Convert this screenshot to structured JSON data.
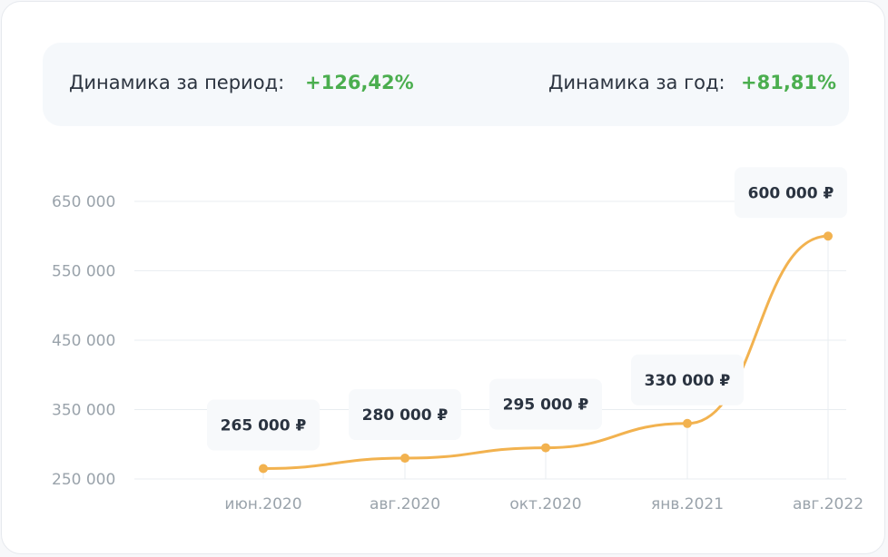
{
  "summary": {
    "period_label": "Динамика за период:",
    "period_value": "+126,42%",
    "year_label": "Динамика за год:",
    "year_value": "+81,81%"
  },
  "colors": {
    "line": "#f2b24f",
    "positive": "#4bae4f"
  },
  "chart_data": {
    "type": "line",
    "title": "",
    "xlabel": "",
    "ylabel": "",
    "categories": [
      "июн.2020",
      "авг.2020",
      "окт.2020",
      "янв.2021",
      "авг.2022"
    ],
    "values": [
      265000,
      280000,
      295000,
      330000,
      600000
    ],
    "data_labels": [
      "265 000 ₽",
      "280 000 ₽",
      "295 000 ₽",
      "330 000 ₽",
      "600 000 ₽"
    ],
    "ylim": [
      250000,
      650000
    ],
    "yticks": [
      250000,
      350000,
      450000,
      550000,
      650000
    ],
    "ytick_labels": [
      "250 000",
      "350 000",
      "450 000",
      "550 000",
      "650 000"
    ],
    "grid": true,
    "legend": "none"
  }
}
